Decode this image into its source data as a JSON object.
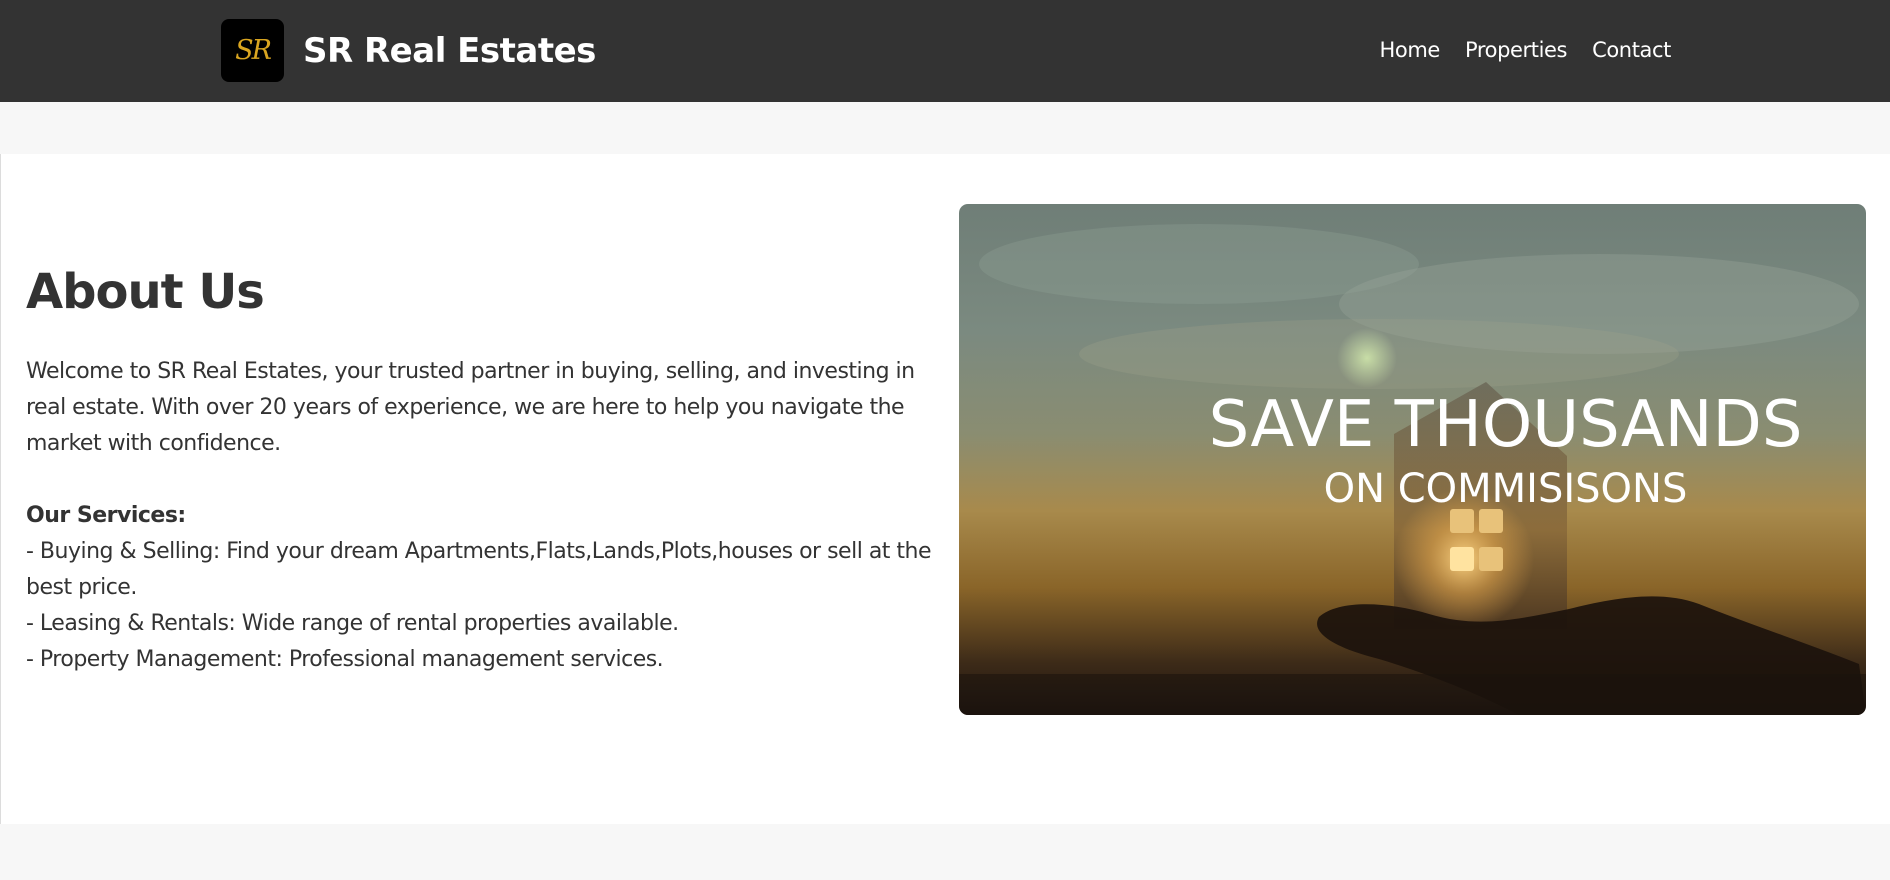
{
  "header": {
    "logo_text": "SR",
    "brand_name": "SR Real Estates",
    "nav": [
      {
        "label": "Home"
      },
      {
        "label": "Properties"
      },
      {
        "label": "Contact"
      }
    ]
  },
  "about": {
    "title": "About Us",
    "intro": "Welcome to SR Real Estates, your trusted partner in buying, selling, and investing in real estate. With over 20 years of experience, we are here to help you navigate the market with confidence.",
    "services_title": "Our Services:",
    "services": [
      "- Buying & Selling: Find your dream Apartments,Flats,Lands,Plots,houses or sell at the best price.",
      "- Leasing & Rentals: Wide range of rental properties available.",
      "- Property Management: Professional management services."
    ]
  },
  "banner": {
    "line1": "SAVE THOUSANDS",
    "line2": "ON COMMISISONS"
  },
  "colors": {
    "navbar": "#333333",
    "page_bg": "#f7f7f7",
    "logo_gold": "#d9a520"
  }
}
